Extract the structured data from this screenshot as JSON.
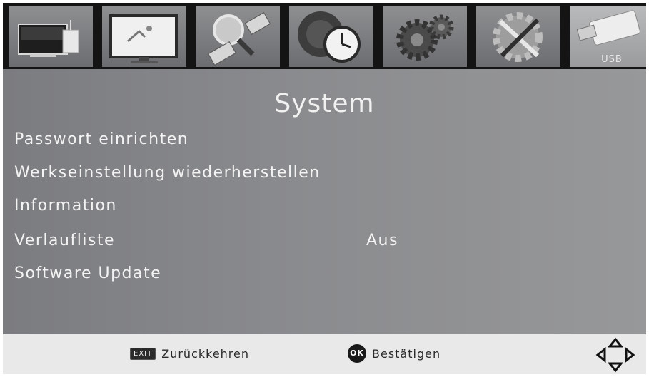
{
  "tabs": [
    {
      "icon": "tv-installation-icon",
      "label": ""
    },
    {
      "icon": "picture-screen-icon",
      "label": ""
    },
    {
      "icon": "channel-search-icon",
      "label": ""
    },
    {
      "icon": "time-clock-icon",
      "label": ""
    },
    {
      "icon": "gears-options-icon",
      "label": ""
    },
    {
      "icon": "system-tools-icon",
      "label": ""
    },
    {
      "icon": "usb-stick-icon",
      "label": "USB"
    }
  ],
  "page_title": "System",
  "menu": {
    "items": [
      {
        "label": "Passwort einrichten",
        "value": ""
      },
      {
        "label": "Werkseinstellung wiederherstellen",
        "value": ""
      },
      {
        "label": "Information",
        "value": ""
      },
      {
        "label": "Verlaufliste",
        "value": "Aus"
      },
      {
        "label": "Software Update",
        "value": ""
      }
    ]
  },
  "footer": {
    "exit_key": "EXIT",
    "exit_label": "Zurückkehren",
    "ok_key": "OK",
    "ok_label": "Bestätigen",
    "nav_icon": "dpad-arrows-icon"
  }
}
